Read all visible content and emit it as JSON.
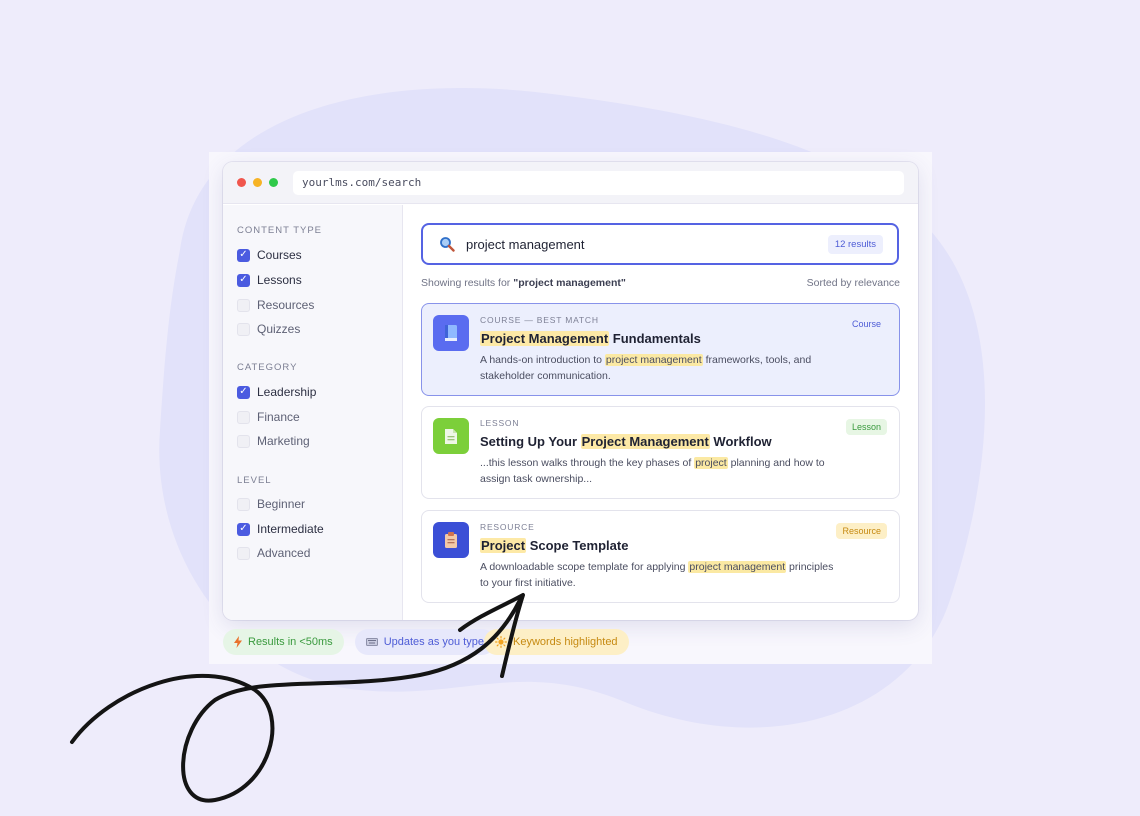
{
  "browser": {
    "url": "yourlms.com/search"
  },
  "filters": [
    {
      "title": "CONTENT TYPE",
      "options": [
        {
          "label": "Courses",
          "checked": true
        },
        {
          "label": "Lessons",
          "checked": true
        },
        {
          "label": "Resources",
          "checked": false
        },
        {
          "label": "Quizzes",
          "checked": false
        }
      ]
    },
    {
      "title": "CATEGORY",
      "options": [
        {
          "label": "Leadership",
          "checked": true
        },
        {
          "label": "Finance",
          "checked": false
        },
        {
          "label": "Marketing",
          "checked": false
        }
      ]
    },
    {
      "title": "LEVEL",
      "options": [
        {
          "label": "Beginner",
          "checked": false
        },
        {
          "label": "Intermediate",
          "checked": true
        },
        {
          "label": "Advanced",
          "checked": false
        }
      ]
    }
  ],
  "search": {
    "query": "project management",
    "count": "12 results"
  },
  "meta": {
    "prefix": "Showing results for ",
    "query_quoted": "\"project management\"",
    "sort": "Sorted by relevance"
  },
  "results": [
    {
      "type": "COURSE — BEST MATCH",
      "title": [
        "Project Management",
        " Fundamentals"
      ],
      "desc": [
        "A hands-on introduction to ",
        "project management",
        " frameworks, tools, and stakeholder communication."
      ],
      "badge": "Course",
      "icon": "book-icon",
      "icon_color": "#5a6cf0"
    },
    {
      "type": "LESSON",
      "title": [
        "Setting Up Your ",
        "Project Management",
        " Workflow"
      ],
      "desc": [
        "...this lesson walks through the key phases of ",
        "project",
        " planning and how to assign task ownership..."
      ],
      "badge": "Lesson",
      "icon": "document-icon",
      "icon_color": "#7ccf3a"
    },
    {
      "type": "RESOURCE",
      "title": [
        "Project",
        " Scope Template"
      ],
      "desc": [
        "A downloadable scope template for applying ",
        "project management",
        " principles to your first initiative."
      ],
      "badge": "Resource",
      "icon": "clipboard-icon",
      "icon_color": "#3b4fd6"
    }
  ],
  "chips": [
    {
      "label": "Results in <50ms",
      "icon": "lightning-icon"
    },
    {
      "label": "Updates as you type",
      "icon": "keyboard-icon"
    },
    {
      "label": "Keywords highlighted",
      "icon": "sun-icon"
    }
  ],
  "colors": {
    "accent": "#4b5be0",
    "course_badge": "#4e5cd6",
    "lesson_badge": "#3a9a3e",
    "resource_badge": "#c68a12"
  }
}
